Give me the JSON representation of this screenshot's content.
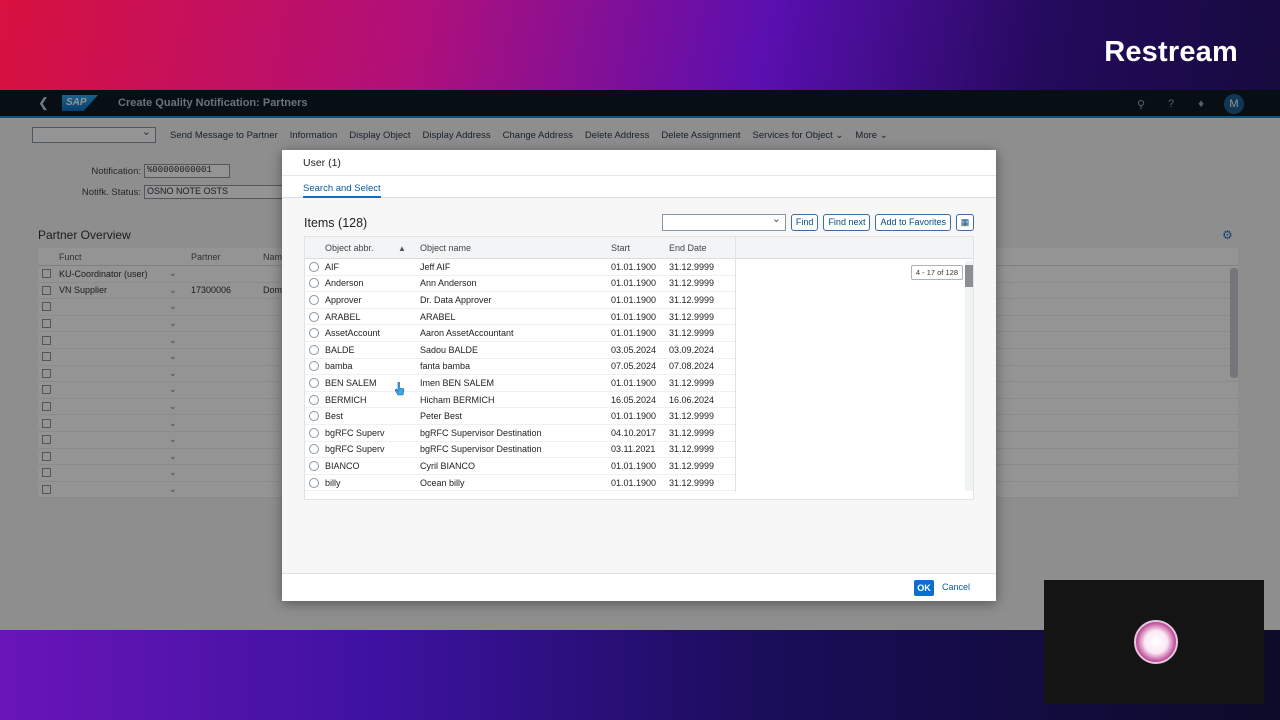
{
  "overlay_brand": "Restream",
  "shell": {
    "title": "Create Quality Notification: Partners",
    "logo": "SAP",
    "back_icon": "back-icon",
    "avatar_letter": "M",
    "accent_color": "#1b90d8"
  },
  "toolbar": {
    "items": [
      "Send Message to Partner",
      "Information",
      "Display Object",
      "Display Address",
      "Change Address",
      "Delete Address",
      "Delete Assignment",
      "Services for Object ⌄",
      "More ⌄"
    ]
  },
  "form": {
    "notification_label": "Notification:",
    "notification_value": "%00000000001",
    "status_label": "Notifk. Status:",
    "status_value": "OSNO NOTE OSTS"
  },
  "partner_overview": {
    "title": "Partner Overview",
    "headers": [
      "Funct",
      "Partner",
      "Nam"
    ],
    "rows": [
      {
        "funct": "KU-Coordinator (user)",
        "partner": "",
        "name": ""
      },
      {
        "funct": "VN Supplier",
        "partner": "17300006",
        "name": "Dom"
      }
    ],
    "empty_rows": 12
  },
  "dialog": {
    "title": "User (1)",
    "tab": "Search and Select",
    "items_title": "Items (128)",
    "find_label": "Find",
    "find_next_label": "Find next",
    "favorites_label": "Add to Favorites",
    "columns": [
      "Object abbr.",
      "Object name",
      "Start",
      "End Date"
    ],
    "scroll_tip": "4 - 17 of 128",
    "rows": [
      {
        "abbr": "AIF",
        "name": "Jeff AIF",
        "start": "01.01.1900",
        "end": "31.12.9999"
      },
      {
        "abbr": "Anderson",
        "name": "Ann Anderson",
        "start": "01.01.1900",
        "end": "31.12.9999"
      },
      {
        "abbr": "Approver",
        "name": "Dr. Data Approver",
        "start": "01.01.1900",
        "end": "31.12.9999"
      },
      {
        "abbr": "ARABEL",
        "name": "ARABEL",
        "start": "01.01.1900",
        "end": "31.12.9999"
      },
      {
        "abbr": "AssetAccount",
        "name": "Aaron AssetAccountant",
        "start": "01.01.1900",
        "end": "31.12.9999"
      },
      {
        "abbr": "BALDE",
        "name": "Sadou BALDE",
        "start": "03.05.2024",
        "end": "03.09.2024"
      },
      {
        "abbr": "bamba",
        "name": "fanta bamba",
        "start": "07.05.2024",
        "end": "07.08.2024"
      },
      {
        "abbr": "BEN SALEM",
        "name": "Imen BEN SALEM",
        "start": "01.01.1900",
        "end": "31.12.9999"
      },
      {
        "abbr": "BERMICH",
        "name": "Hicham BERMICH",
        "start": "16.05.2024",
        "end": "16.06.2024"
      },
      {
        "abbr": "Best",
        "name": "Peter Best",
        "start": "01.01.1900",
        "end": "31.12.9999"
      },
      {
        "abbr": "bgRFC Superv",
        "name": "bgRFC Supervisor Destination",
        "start": "04.10.2017",
        "end": "31.12.9999"
      },
      {
        "abbr": "bgRFC Superv",
        "name": "bgRFC Supervisor Destination",
        "start": "03.11.2021",
        "end": "31.12.9999"
      },
      {
        "abbr": "BIANCO",
        "name": "Cyril BIANCO",
        "start": "01.01.1900",
        "end": "31.12.9999"
      },
      {
        "abbr": "billy",
        "name": "Ocean billy",
        "start": "01.01.1900",
        "end": "31.12.9999"
      }
    ],
    "ok_label": "OK",
    "cancel_label": "Cancel"
  }
}
